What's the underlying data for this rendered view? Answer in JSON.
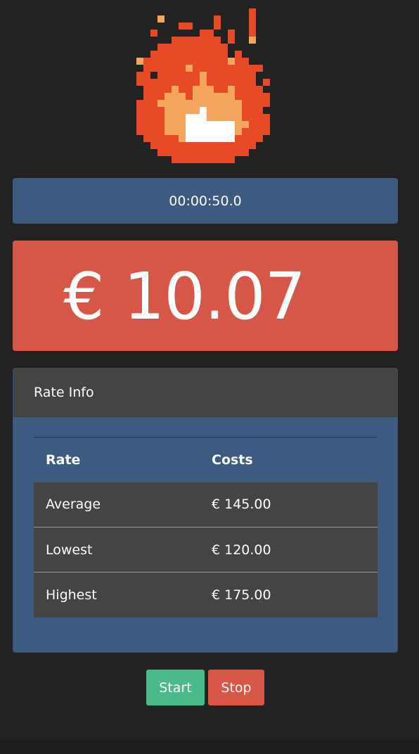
{
  "colors": {
    "background": "#222222",
    "timer_panel": "#3d5a80",
    "cost_panel": "#d65748",
    "card_header": "#444444",
    "start_button": "#4cb98b",
    "stop_button": "#d65748",
    "flame_dark": "#e64a26",
    "flame_light": "#f5a55c",
    "flame_core": "#ffffff"
  },
  "logo": {
    "icon": "pixel-fire-icon"
  },
  "timer": {
    "value": "00:00:50.0"
  },
  "cost": {
    "value": "€ 10.07"
  },
  "rate_info": {
    "title": "Rate Info",
    "headers": {
      "rate": "Rate",
      "costs": "Costs"
    },
    "rows": [
      {
        "rate": "Average",
        "costs": "€ 145.00"
      },
      {
        "rate": "Lowest",
        "costs": "€ 120.00"
      },
      {
        "rate": "Highest",
        "costs": "€ 175.00"
      }
    ]
  },
  "controls": {
    "start_label": "Start",
    "stop_label": "Stop"
  }
}
